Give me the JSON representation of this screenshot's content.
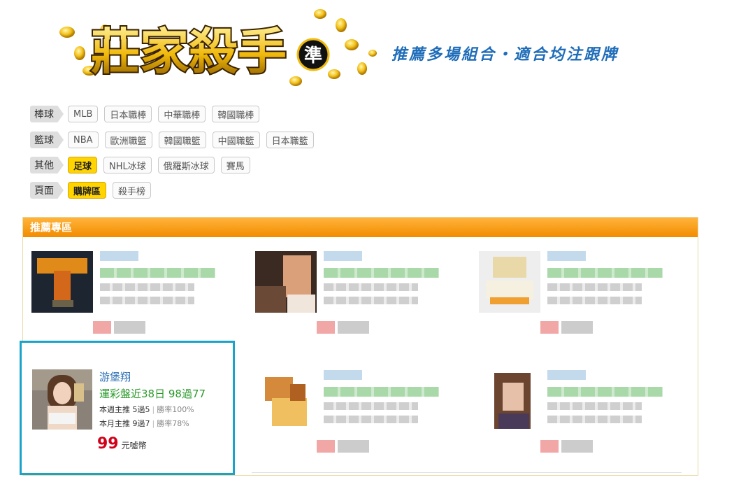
{
  "header": {
    "logo_text": "莊家殺手",
    "logo_badge": "準",
    "slogan": "推薦多場組合・適合均注跟牌"
  },
  "filters": [
    {
      "label": "棒球",
      "items": [
        {
          "text": "MLB",
          "active": false
        },
        {
          "text": "日本職棒",
          "active": false
        },
        {
          "text": "中華職棒",
          "active": false
        },
        {
          "text": "韓國職棒",
          "active": false
        }
      ]
    },
    {
      "label": "籃球",
      "items": [
        {
          "text": "NBA",
          "active": false
        },
        {
          "text": "歐洲職籃",
          "active": false
        },
        {
          "text": "韓國職籃",
          "active": false
        },
        {
          "text": "中國職籃",
          "active": false
        },
        {
          "text": "日本職籃",
          "active": false
        }
      ]
    },
    {
      "label": "其他",
      "items": [
        {
          "text": "足球",
          "active": true
        },
        {
          "text": "NHL冰球",
          "active": false
        },
        {
          "text": "俄羅斯冰球",
          "active": false
        },
        {
          "text": "賽馬",
          "active": false
        }
      ]
    },
    {
      "label": "頁面",
      "items": [
        {
          "text": "購牌區",
          "active": true
        },
        {
          "text": "殺手榜",
          "active": false
        }
      ]
    }
  ],
  "recommend": {
    "title": "推薦專區",
    "featured": {
      "name": "游堡翔",
      "record": "運彩盤近38日 98過77",
      "week_label": "本週主推 5過5",
      "week_rate": "勝率100%",
      "month_label": "本月主推 9過7",
      "month_rate": "勝率78%",
      "price": "99",
      "price_unit": "元噓幣"
    }
  },
  "colors": {
    "accent_orange": "#f28c00",
    "active_yellow": "#ffd400",
    "highlight_border": "#1aa3c9",
    "slogan_blue": "#1f6db9",
    "price_red": "#d0021b"
  }
}
